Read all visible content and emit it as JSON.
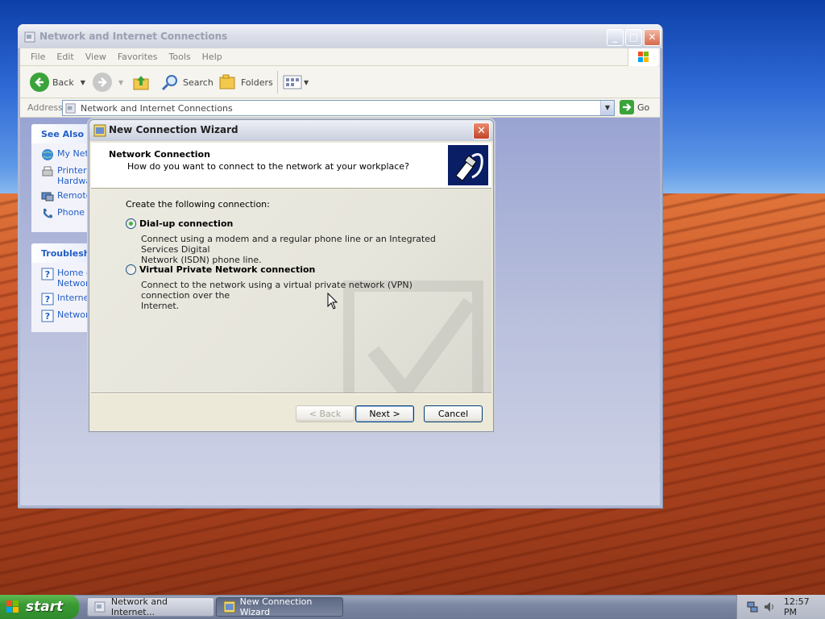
{
  "explorer": {
    "title": "Network and Internet Connections",
    "menu": [
      "File",
      "Edit",
      "View",
      "Favorites",
      "Tools",
      "Help"
    ],
    "toolbar": {
      "back": "Back",
      "search": "Search",
      "folders": "Folders"
    },
    "address": {
      "label": "Address",
      "value": "Network and Internet Connections",
      "go": "Go"
    },
    "see_also": {
      "title": "See Also",
      "items": [
        "My Netw",
        "Printers",
        "Hardwa",
        "Remote",
        "Phone a"
      ]
    },
    "troubleshooters": {
      "title": "Troublesho",
      "items": [
        "Home o",
        "Networ",
        "Interne",
        "Networ"
      ]
    }
  },
  "wizard": {
    "title": "New Connection Wizard",
    "header_title": "Network Connection",
    "header_subtitle": "How do you want to connect to the network at your workplace?",
    "intro": "Create the following connection:",
    "options": [
      {
        "label": "Dial-up connection",
        "desc_line1": "Connect using a modem and a regular phone line or an Integrated Services Digital",
        "desc_line2": "Network (ISDN) phone line.",
        "selected": true
      },
      {
        "label": "Virtual Private Network connection",
        "desc_line1": "Connect to the network using a virtual private network (VPN) connection over the",
        "desc_line2": "Internet.",
        "selected": false
      }
    ],
    "buttons": {
      "back": "< Back",
      "next": "Next >",
      "cancel": "Cancel"
    }
  },
  "taskbar": {
    "start": "start",
    "tasks": [
      "Network and Internet...",
      "New Connection Wizard"
    ],
    "clock": "12:57 PM"
  },
  "colors": {
    "xp_link_blue": "#215dc6",
    "start_green": "#3b9a35",
    "radio_dot": "#3cb83c"
  }
}
